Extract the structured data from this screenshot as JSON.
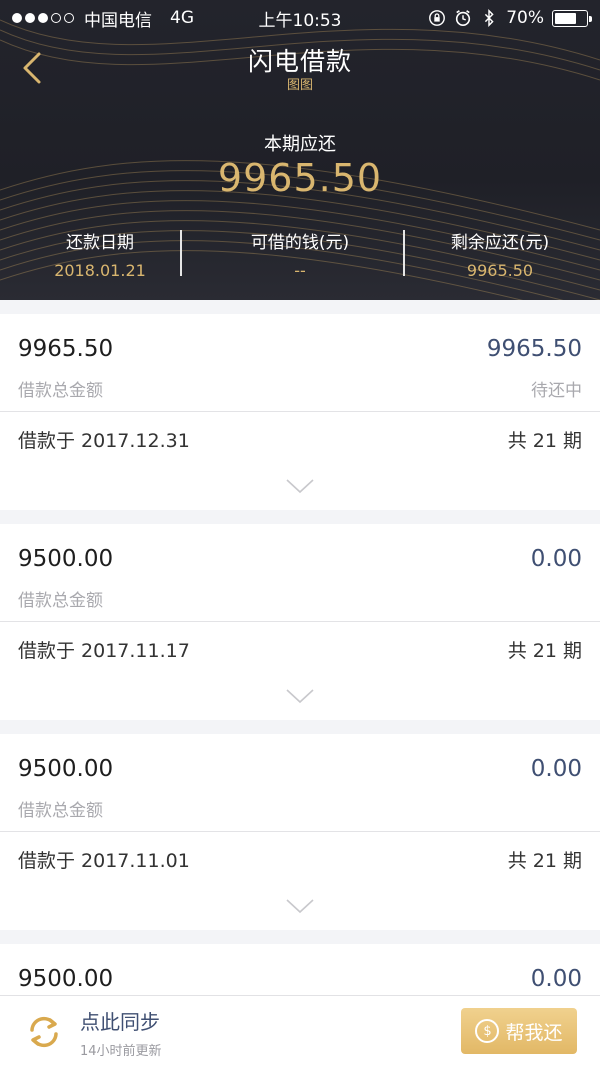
{
  "status_bar": {
    "carrier": "中国电信",
    "network": "4G",
    "time": "上午10:53",
    "battery": "70%",
    "battery_level": 0.7,
    "icons": [
      "lock-rotation-icon",
      "alarm-icon",
      "bluetooth-icon"
    ]
  },
  "nav": {
    "title": "闪电借款",
    "subtitle": "图图",
    "back_icon": "chevron-left-icon"
  },
  "summary": {
    "period_label": "本期应还",
    "period_amount": "9965.50",
    "stats": [
      {
        "label": "还款日期",
        "value": "2018.01.21"
      },
      {
        "label": "可借的钱(元)",
        "value": "--"
      },
      {
        "label": "剩余应还(元)",
        "value": "9965.50"
      }
    ]
  },
  "loans": [
    {
      "amount": "9965.50",
      "amount_label": "借款总金额",
      "status_amount": "9965.50",
      "status_label": "待还中",
      "date_text": "借款于 2017.12.31",
      "periods": "共 21 期"
    },
    {
      "amount": "9500.00",
      "amount_label": "借款总金额",
      "status_amount": "0.00",
      "status_label": "",
      "date_text": "借款于 2017.11.17",
      "periods": "共 21 期"
    },
    {
      "amount": "9500.00",
      "amount_label": "借款总金额",
      "status_amount": "0.00",
      "status_label": "",
      "date_text": "借款于 2017.11.01",
      "periods": "共 21 期"
    },
    {
      "amount": "9500.00",
      "amount_label": "",
      "status_amount": "0.00",
      "status_label": "",
      "date_text": "",
      "periods": ""
    }
  ],
  "bottom_bar": {
    "sync_title": "点此同步",
    "sync_time": "14小时前更新",
    "help_button": "帮我还",
    "sync_icon": "sync-icon",
    "coin_icon": "dollar-coin-icon"
  },
  "colors": {
    "header_bg": "#1f2027",
    "gold": "#d9b66f",
    "navy_text": "#3f4f72",
    "button_gold": "#e2b866"
  }
}
